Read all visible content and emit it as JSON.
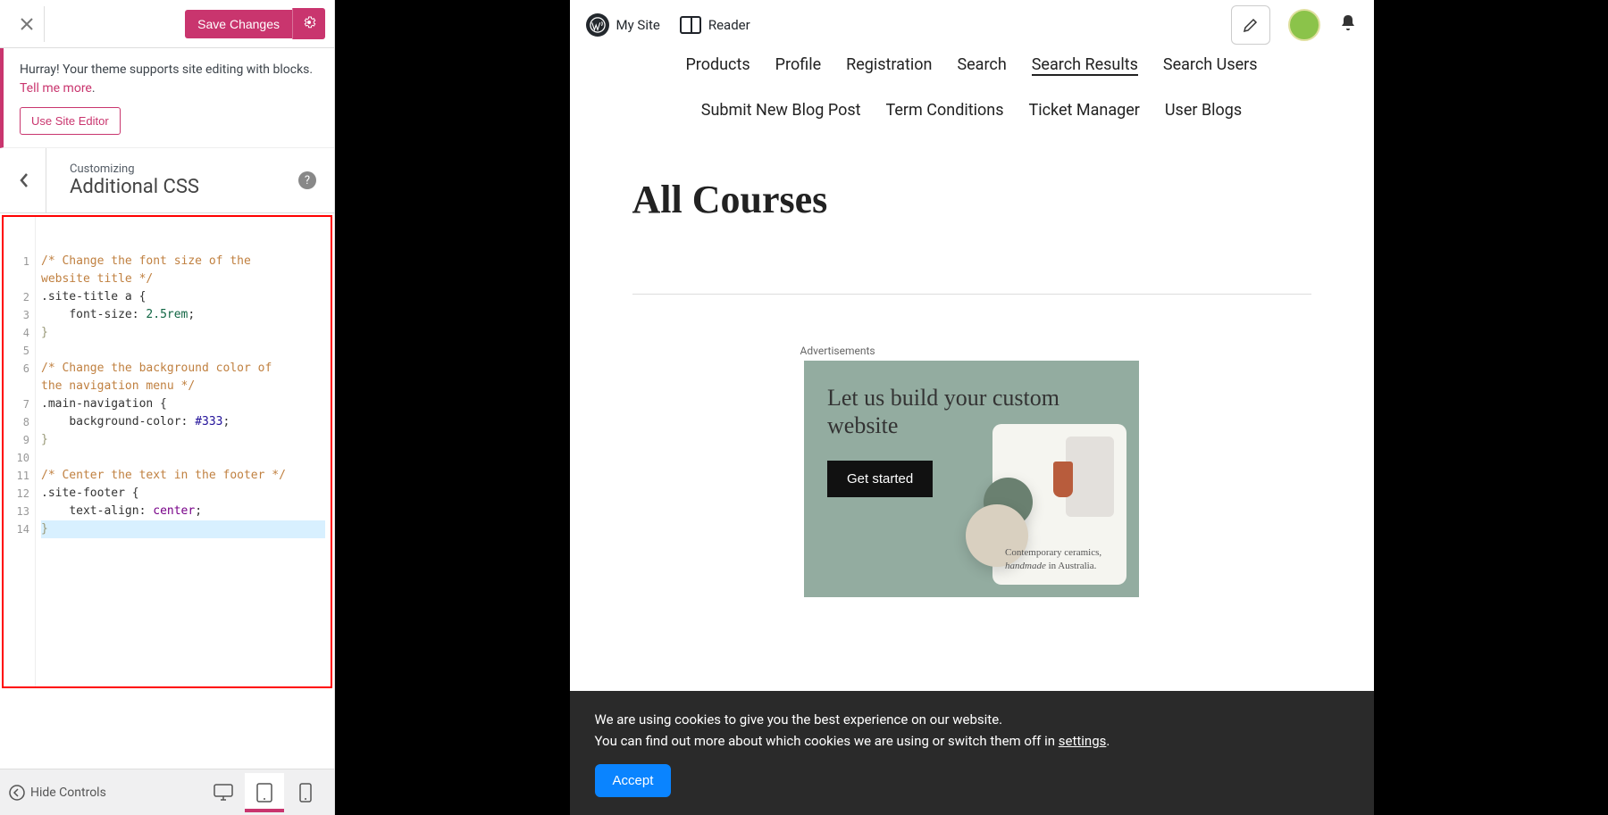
{
  "customizer": {
    "save_button": "Save Changes",
    "notice_text": "Hurray! Your theme supports site editing with blocks. ",
    "tell_more": "Tell me more",
    "use_site_editor": "Use Site Editor",
    "customizing_label": "Customizing",
    "section_title": "Additional CSS",
    "hide_controls": "Hide Controls"
  },
  "code": {
    "line1a": "/* Change the font size of the ",
    "line1b": "website title */",
    "line2": ".site-title a {",
    "line3_indent": "    ",
    "line3_prop": "font-size",
    "line3_colon": ": ",
    "line3_val": "2.5rem",
    "line3_semi": ";",
    "line4": "}",
    "line6a": "/* Change the background color of ",
    "line6b": "the navigation menu */",
    "line7": ".main-navigation {",
    "line8_prop": "background-color",
    "line8_val": "#333",
    "line9": "}",
    "line11": "/* Center the text in the footer */",
    "line12": ".site-footer {",
    "line13_prop": "text-align",
    "line13_val": "center",
    "line14": "}"
  },
  "toolbar": {
    "my_site": "My Site",
    "reader": "Reader"
  },
  "nav": {
    "products": "Products",
    "profile": "Profile",
    "registration": "Registration",
    "search": "Search",
    "search_results": "Search Results",
    "search_users": "Search Users",
    "submit_post": "Submit New Blog Post",
    "term_conditions": "Term Conditions",
    "ticket_manager": "Ticket Manager",
    "user_blogs": "User Blogs"
  },
  "page": {
    "heading": "All Courses",
    "ad_label": "Advertisements"
  },
  "ad": {
    "title": "Let us build your custom website",
    "button": "Get started",
    "mock_text_1": "Contemporary ceramics,",
    "mock_text_2": "handmade",
    "mock_text_3": " in Australia."
  },
  "cookies": {
    "line1": "We are using cookies to give you the best experience on our website.",
    "line2a": "You can find out more about which cookies we are using or switch them off in ",
    "line2b": "settings",
    "accept": "Accept"
  }
}
